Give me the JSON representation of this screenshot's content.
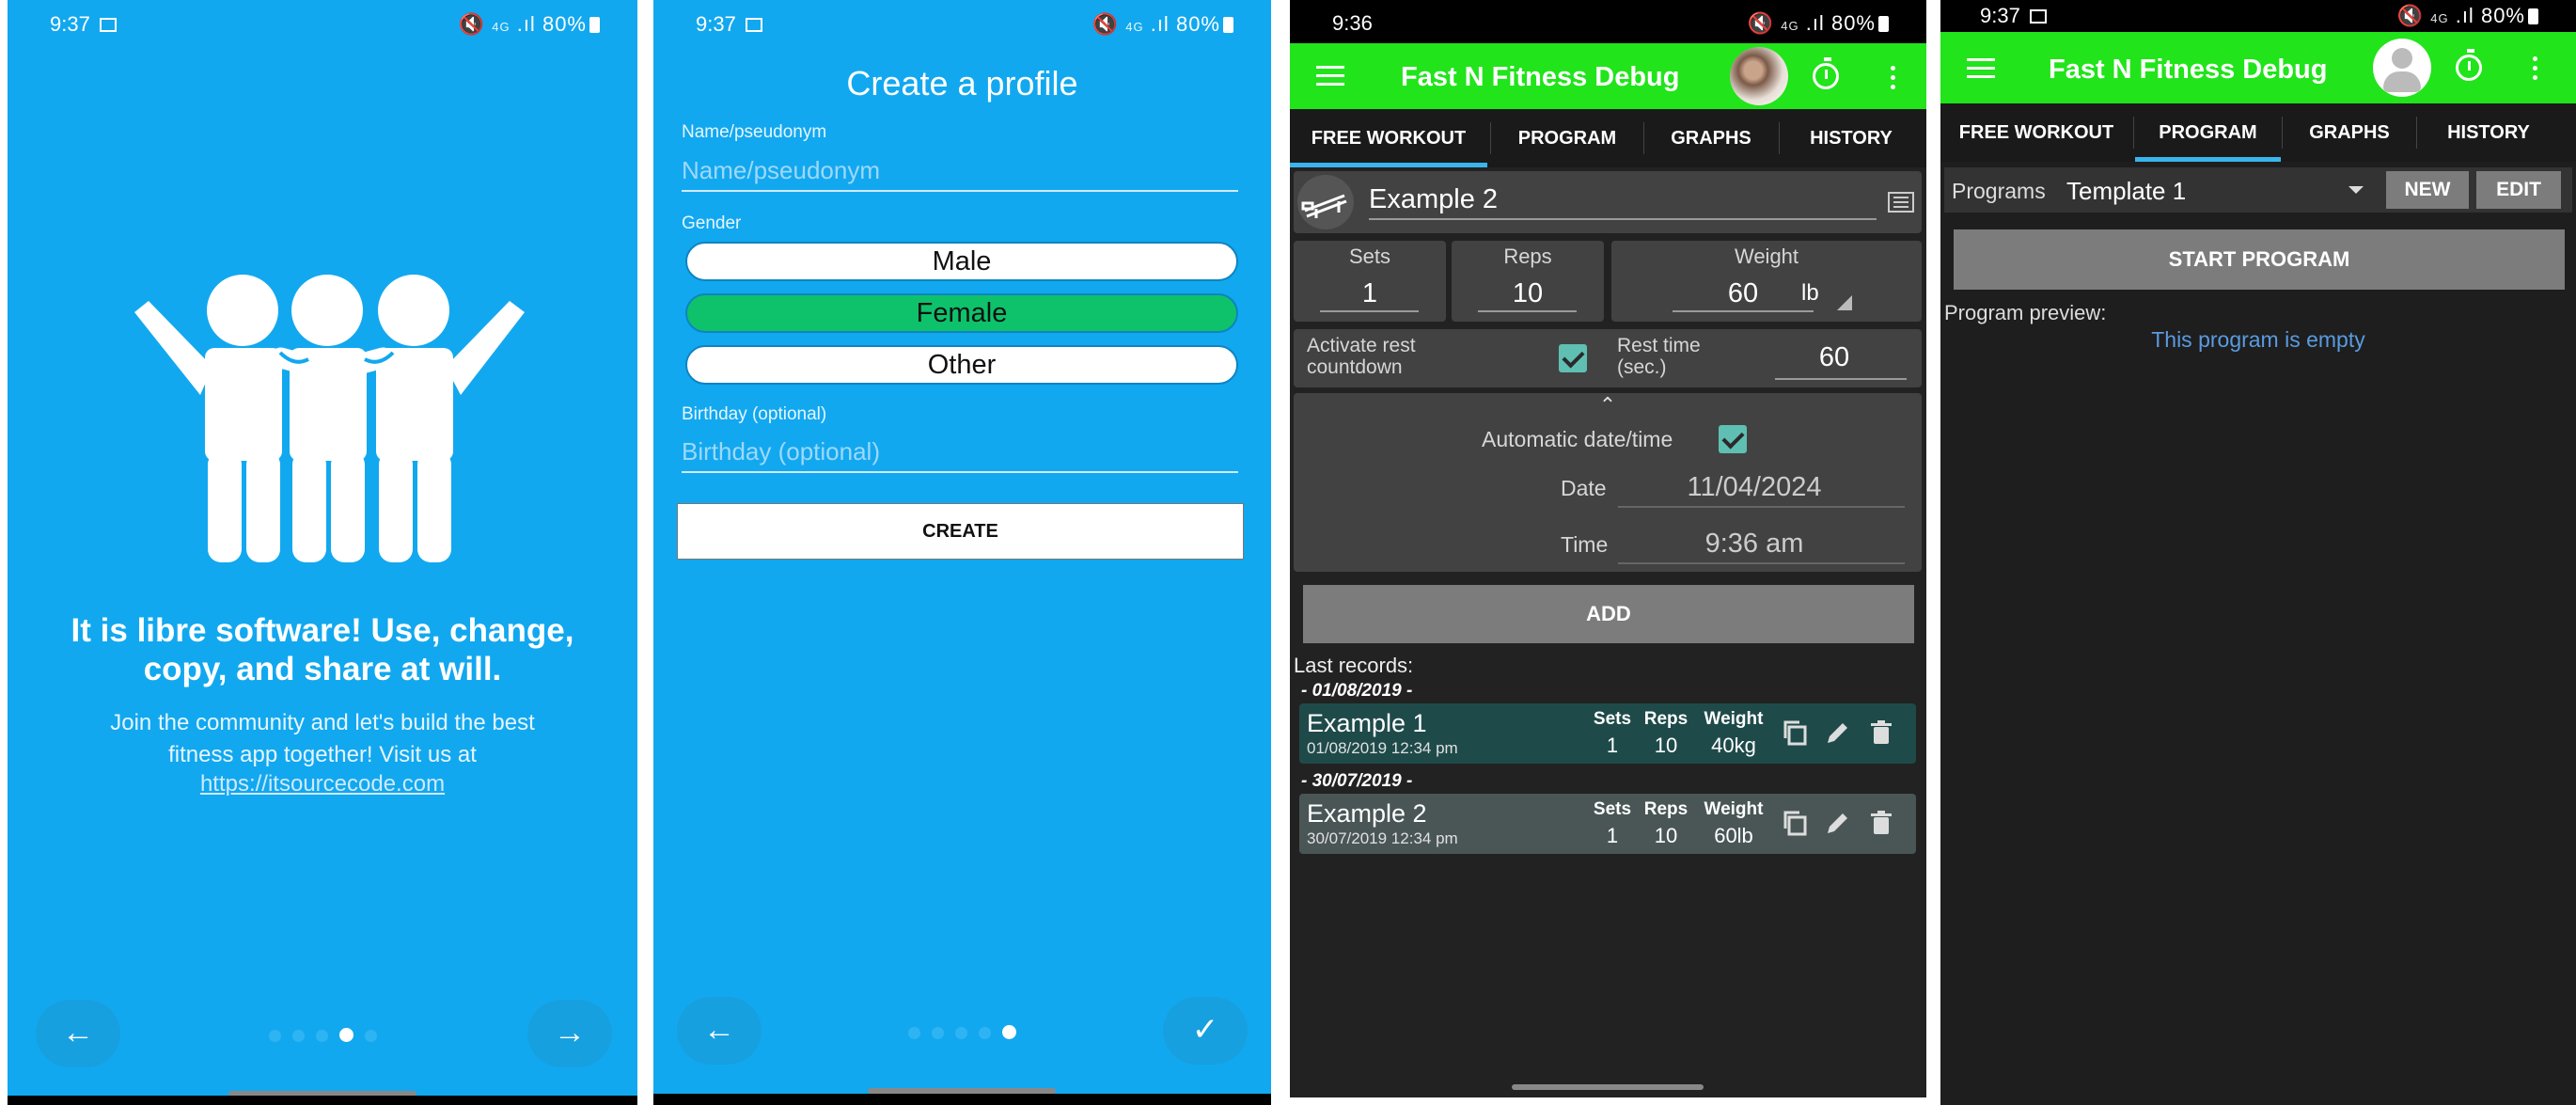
{
  "screen1": {
    "status": {
      "time": "9:37",
      "battery": "80%",
      "net": "Vo) 4G\nLTE1",
      "signal": ".ıl"
    },
    "title": "It is libre software! Use, change, copy, and share at will.",
    "body": "Join the community and let's build the best fitness app together! Visit us at",
    "link": "https://itsourcecode.com",
    "prev_icon": "arrow-left",
    "next_icon": "arrow-right",
    "page_indicator": {
      "count": 5,
      "active": 4
    }
  },
  "screen2": {
    "status": {
      "time": "9:37",
      "battery": "80%"
    },
    "title": "Create a profile",
    "name_label": "Name/pseudonym",
    "name_placeholder": "Name/pseudonym",
    "gender_label": "Gender",
    "gender_options": [
      "Male",
      "Female",
      "Other"
    ],
    "gender_selected": "Female",
    "birthday_label": "Birthday (optional)",
    "birthday_placeholder": "Birthday (optional)",
    "create_label": "CREATE",
    "page_indicator": {
      "count": 5,
      "active": 5
    }
  },
  "screen3": {
    "status": {
      "time": "9:36",
      "battery": "80%"
    },
    "app_title": "Fast N Fitness Debug",
    "tabs": [
      "FREE WORKOUT",
      "PROGRAM",
      "GRAPHS",
      "HISTORY"
    ],
    "active_tab": "FREE WORKOUT",
    "exercise": "Example 2",
    "sets_label": "Sets",
    "sets": "1",
    "reps_label": "Reps",
    "reps": "10",
    "weight_label": "Weight",
    "weight": "60",
    "unit": "lb",
    "rest_label": "Activate rest countdown",
    "rest_time_label": "Rest time (sec.)",
    "rest_time": "60",
    "auto_dt_label": "Automatic date/time",
    "date_label": "Date",
    "date": "11/04/2024",
    "time_label": "Time",
    "time": "9:36 am",
    "add_label": "ADD",
    "last_records_label": "Last records:",
    "groups": [
      {
        "date": "- 01/08/2019 -",
        "name": "Example 1",
        "stamp": "01/08/2019  12:34 pm",
        "sets": "1",
        "reps": "10",
        "weight": "40kg"
      },
      {
        "date": "- 30/07/2019 -",
        "name": "Example 2",
        "stamp": "30/07/2019  12:34 pm",
        "sets": "1",
        "reps": "10",
        "weight": "60lb"
      }
    ],
    "col_sets": "Sets",
    "col_reps": "Reps",
    "col_weight": "Weight",
    "colors": {
      "appbar": "#21e41b",
      "record1": "#1f4a4a",
      "record2": "#4a5656"
    }
  },
  "screen4": {
    "status": {
      "time": "9:37",
      "battery": "80%"
    },
    "app_title": "Fast N Fitness Debug",
    "tabs": [
      "FREE WORKOUT",
      "PROGRAM",
      "GRAPHS",
      "HISTORY"
    ],
    "active_tab": "PROGRAM",
    "programs_label": "Programs",
    "program": "Template 1",
    "new_label": "NEW",
    "edit_label": "EDIT",
    "start_label": "START PROGRAM",
    "preview_label": "Program preview:",
    "empty_label": "This program is empty"
  }
}
